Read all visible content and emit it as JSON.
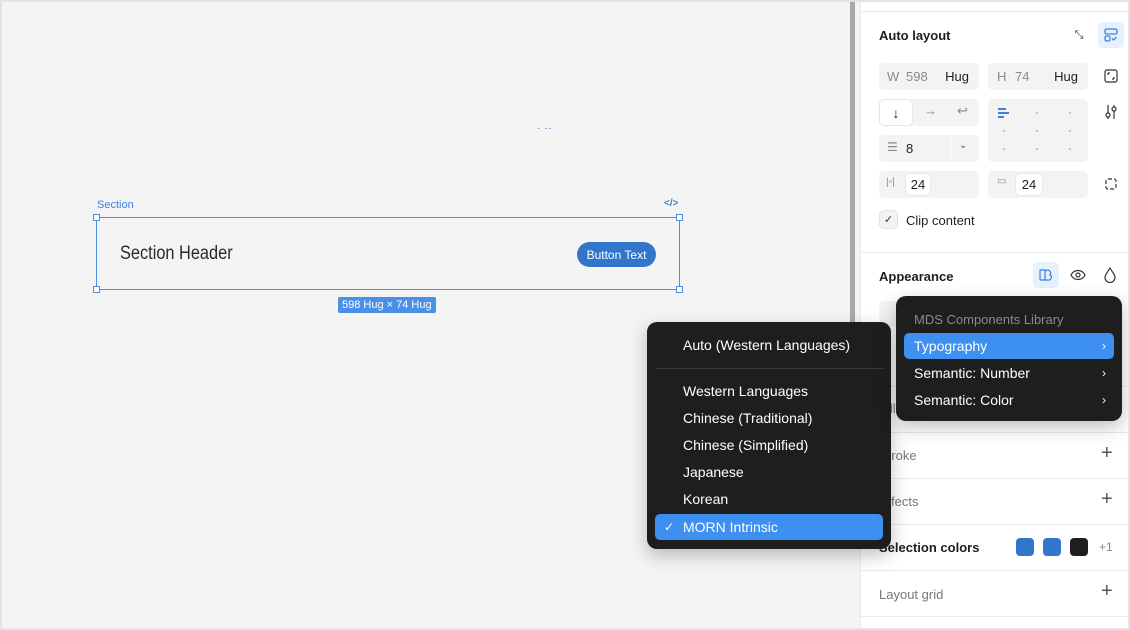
{
  "canvas": {
    "frame_label": "Section",
    "code_icon": "code-icon",
    "section_header": "Section Header",
    "button_text": "Button Text",
    "dimension_badge": "598 Hug × 74 Hug",
    "dashes": "- --"
  },
  "panel": {
    "auto_layout": {
      "title": "Auto layout",
      "width_label": "W",
      "width_value": "598",
      "width_mode": "Hug",
      "height_label": "H",
      "height_value": "74",
      "height_mode": "Hug",
      "gap_value": "8",
      "padding_horizontal": "24",
      "padding_vertical": "24",
      "clip_content_label": "Clip content",
      "clip_content_checked": true
    },
    "appearance": {
      "title": "Appearance"
    },
    "stroke": {
      "title": "Stroke"
    },
    "effects": {
      "title": "Effects"
    },
    "selection_colors": {
      "title": "Selection colors",
      "colors": [
        "#3276cb",
        "#3276cb",
        "#1e1e1e"
      ],
      "more": "+1"
    },
    "layout_grid": {
      "title": "Layout grid"
    }
  },
  "language_menu": {
    "auto": "Auto (Western Languages)",
    "items": [
      "Western Languages",
      "Chinese (Traditional)",
      "Chinese (Simplified)",
      "Japanese",
      "Korean",
      "MORN Intrinsic"
    ],
    "selected": "MORN Intrinsic",
    "check": "✓"
  },
  "library_menu": {
    "header": "MDS Components Library",
    "items": [
      "Typography",
      "Semantic: Number",
      "Semantic: Color"
    ],
    "selected": "Typography",
    "arrow": "›"
  }
}
